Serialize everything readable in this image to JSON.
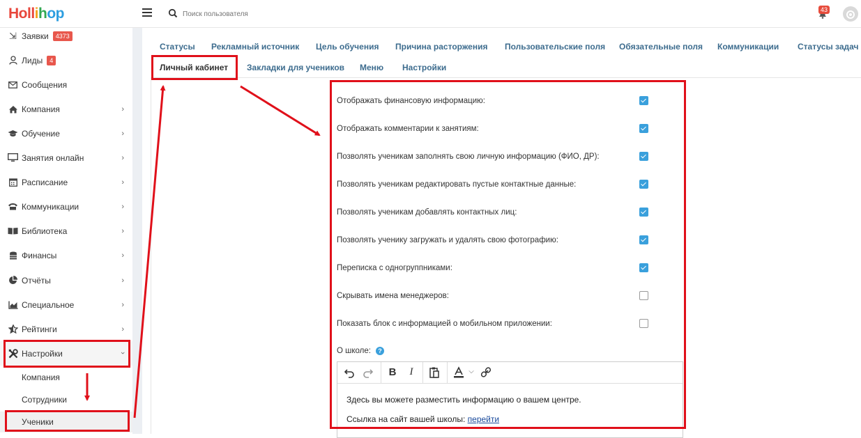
{
  "app": {
    "logo": "Hollihop"
  },
  "header": {
    "search_placeholder": "Поиск пользователя",
    "notifications_count": "43"
  },
  "sidebar": {
    "items": [
      {
        "label": "Заявки",
        "badge": "4373",
        "icon": "enter-icon"
      },
      {
        "label": "Лиды",
        "badge": "4",
        "icon": "user-icon"
      },
      {
        "label": "Сообщения",
        "icon": "envelope-icon"
      },
      {
        "label": "Компания",
        "icon": "home-icon"
      },
      {
        "label": "Обучение",
        "icon": "graduation-cap-icon"
      },
      {
        "label": "Занятия онлайн",
        "icon": "monitor-icon"
      },
      {
        "label": "Расписание",
        "icon": "calendar-icon"
      },
      {
        "label": "Коммуникации",
        "icon": "phone-icon"
      },
      {
        "label": "Библиотека",
        "icon": "book-icon"
      },
      {
        "label": "Финансы",
        "icon": "coins-icon"
      },
      {
        "label": "Отчёты",
        "icon": "pie-chart-icon"
      },
      {
        "label": "Специальное",
        "icon": "area-chart-icon"
      },
      {
        "label": "Рейтинги",
        "icon": "star-icon"
      },
      {
        "label": "Настройки",
        "icon": "tools-icon"
      }
    ],
    "sub_items": [
      {
        "label": "Компания"
      },
      {
        "label": "Сотрудники"
      },
      {
        "label": "Ученики"
      }
    ]
  },
  "tabs": {
    "row1": [
      "Статусы",
      "Рекламный источник",
      "Цель обучения",
      "Причина расторжения",
      "Пользовательские поля",
      "Обязательные поля",
      "Коммуникации",
      "Статусы задач"
    ],
    "row2": [
      "Личный кабинет",
      "Закладки для учеников",
      "Меню",
      "Настройки"
    ]
  },
  "settings": [
    {
      "label": "Отображать финансовую информацию:",
      "checked": true
    },
    {
      "label": "Отображать комментарии к занятиям:",
      "checked": true
    },
    {
      "label": "Позволять ученикам заполнять свою личную информацию (ФИО, ДР):",
      "checked": true
    },
    {
      "label": "Позволять ученикам редактировать пустые контактные данные:",
      "checked": true
    },
    {
      "label": "Позволять ученикам добавлять контактных лиц:",
      "checked": true
    },
    {
      "label": "Позволять ученику загружать и удалять свою фотографию:",
      "checked": true
    },
    {
      "label": "Переписка с одногруппниками:",
      "checked": true
    },
    {
      "label": "Скрывать имена менеджеров:",
      "checked": false
    },
    {
      "label": "Показать блок с информацией о мобильном приложении:",
      "checked": false
    }
  ],
  "about": {
    "label": "О школе:",
    "help": "?",
    "line1": "Здесь вы можете разместить информацию о вашем центре.",
    "line2_prefix": "Ссылка на сайт вашей школы:",
    "line2_link": "перейти"
  },
  "colors": {
    "accent": "#3aa0dc",
    "highlight": "#e0101a",
    "link": "#3d6c8e",
    "badge": "#e8574c"
  }
}
